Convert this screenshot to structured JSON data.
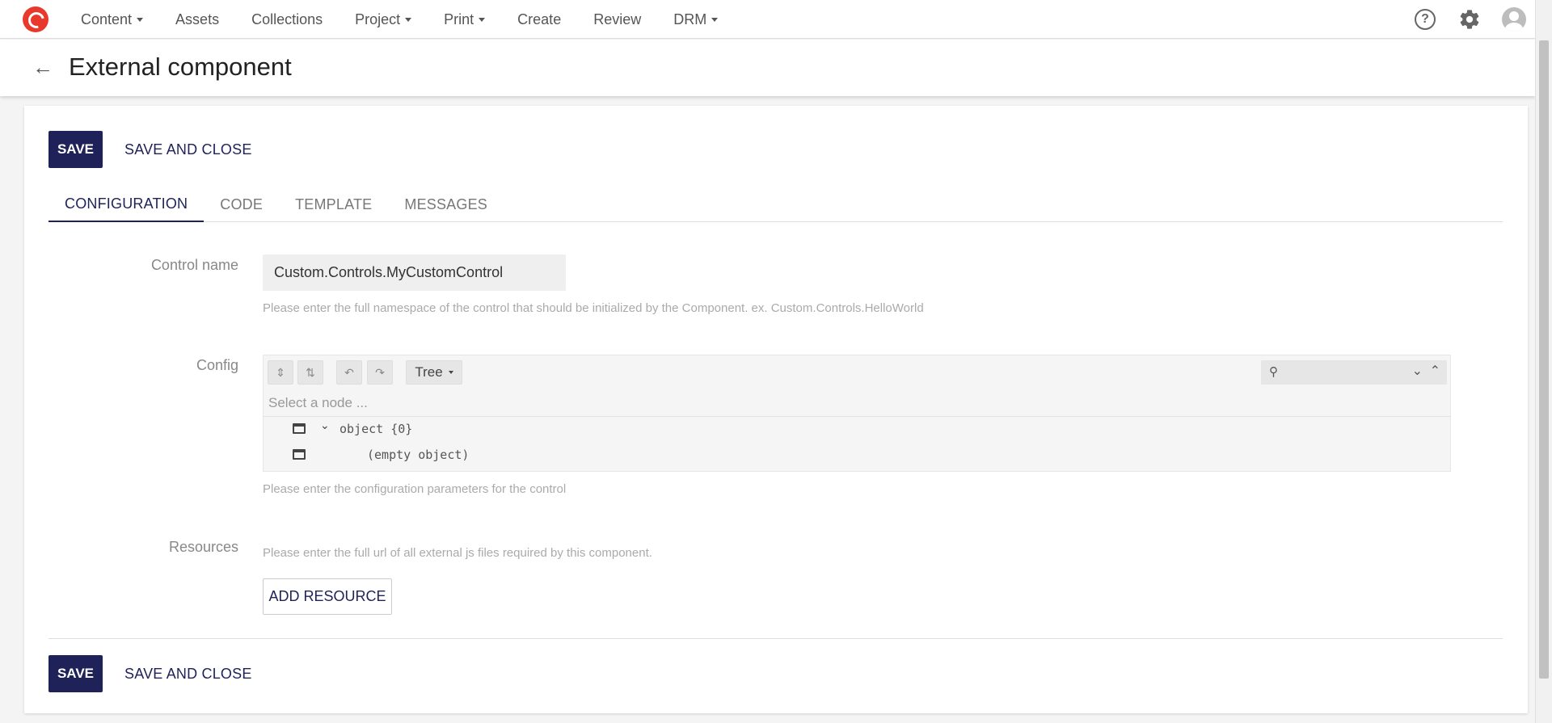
{
  "nav": {
    "items": [
      {
        "label": "Content",
        "dropdown": true
      },
      {
        "label": "Assets",
        "dropdown": false
      },
      {
        "label": "Collections",
        "dropdown": false
      },
      {
        "label": "Project",
        "dropdown": true
      },
      {
        "label": "Print",
        "dropdown": true
      },
      {
        "label": "Create",
        "dropdown": false
      },
      {
        "label": "Review",
        "dropdown": false
      },
      {
        "label": "DRM",
        "dropdown": true
      }
    ],
    "help_symbol": "?",
    "icons": [
      "logo-icon",
      "help-icon",
      "gear-icon",
      "avatar"
    ]
  },
  "header": {
    "title": "External component"
  },
  "actions": {
    "save_label": "SAVE",
    "save_close_label": "SAVE AND CLOSE"
  },
  "tabs": [
    {
      "label": "CONFIGURATION",
      "active": true
    },
    {
      "label": "CODE",
      "active": false
    },
    {
      "label": "TEMPLATE",
      "active": false
    },
    {
      "label": "MESSAGES",
      "active": false
    }
  ],
  "form": {
    "control_name": {
      "label": "Control name",
      "value": "Custom.Controls.MyCustomControl",
      "hint": "Please enter the full namespace of the control that should be initialized by the Component. ex. Custom.Controls.HelloWorld"
    },
    "config": {
      "label": "Config",
      "mode": "Tree",
      "breadcrumb_placeholder": "Select a node ...",
      "rows": [
        {
          "text": "object {0}"
        },
        {
          "text": "(empty object)"
        }
      ],
      "hint": "Please enter the configuration parameters for the control"
    },
    "resources": {
      "label": "Resources",
      "hint": "Please enter the full url of all external js files required by this component.",
      "add_label": "ADD RESOURCE"
    }
  },
  "colors": {
    "primary": "#1e2259",
    "logo": "#e8392c"
  }
}
